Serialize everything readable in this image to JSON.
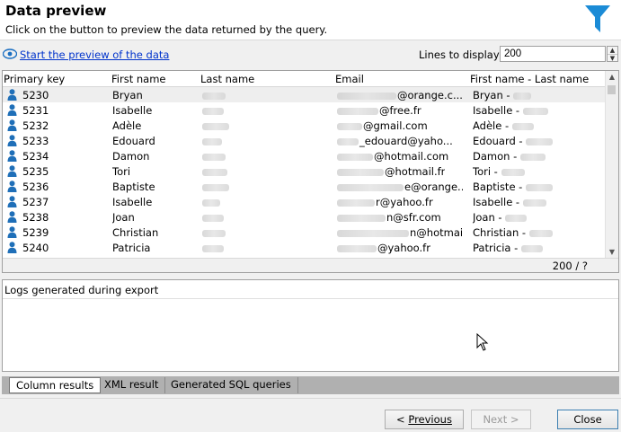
{
  "header": {
    "title": "Data preview",
    "subtitle": "Click on the button to preview the data returned by the query.",
    "icon": "funnel-icon",
    "icon_color": "#1b8bd6"
  },
  "toolbar": {
    "preview_link": "Start the preview of the data",
    "lines_label": "Lines to display:",
    "lines_value": "200"
  },
  "grid": {
    "columns": [
      "Primary key",
      "First name",
      "Last name",
      "Email",
      "First name - Last name"
    ],
    "rows": [
      {
        "key": "5230",
        "first": "Bryan",
        "email_domain": "@orange.c...",
        "full": "Bryan - "
      },
      {
        "key": "5231",
        "first": "Isabelle",
        "email_domain": "@free.fr",
        "full": "Isabelle - "
      },
      {
        "key": "5232",
        "first": "Adèle",
        "email_domain": "@gmail.com",
        "full": "Adèle - "
      },
      {
        "key": "5233",
        "first": "Edouard",
        "email_domain": "_edouard@yaho...",
        "full": "Edouard - "
      },
      {
        "key": "5234",
        "first": "Damon",
        "email_domain": "@hotmail.com",
        "full": "Damon - "
      },
      {
        "key": "5235",
        "first": "Tori",
        "email_domain": "@hotmail.fr",
        "full": "Tori - "
      },
      {
        "key": "5236",
        "first": "Baptiste",
        "email_domain": "e@orange...",
        "full": "Baptiste - "
      },
      {
        "key": "5237",
        "first": "Isabelle",
        "email_domain": "r@yahoo.fr",
        "full": "Isabelle - "
      },
      {
        "key": "5238",
        "first": "Joan",
        "email_domain": "n@sfr.com",
        "full": "Joan - "
      },
      {
        "key": "5239",
        "first": "Christian",
        "email_domain": "n@hotmai...",
        "full": "Christian - "
      },
      {
        "key": "5240",
        "first": "Patricia",
        "email_domain": "@yahoo.fr",
        "full": "Patricia - "
      }
    ],
    "count": "200 / ?"
  },
  "logs": {
    "title": "Logs generated during export"
  },
  "tabs": [
    "Column results",
    "XML result",
    "Generated SQL queries"
  ],
  "footer": {
    "previous_label": "Previous",
    "next_label": "Next >",
    "close_label": "Close"
  }
}
